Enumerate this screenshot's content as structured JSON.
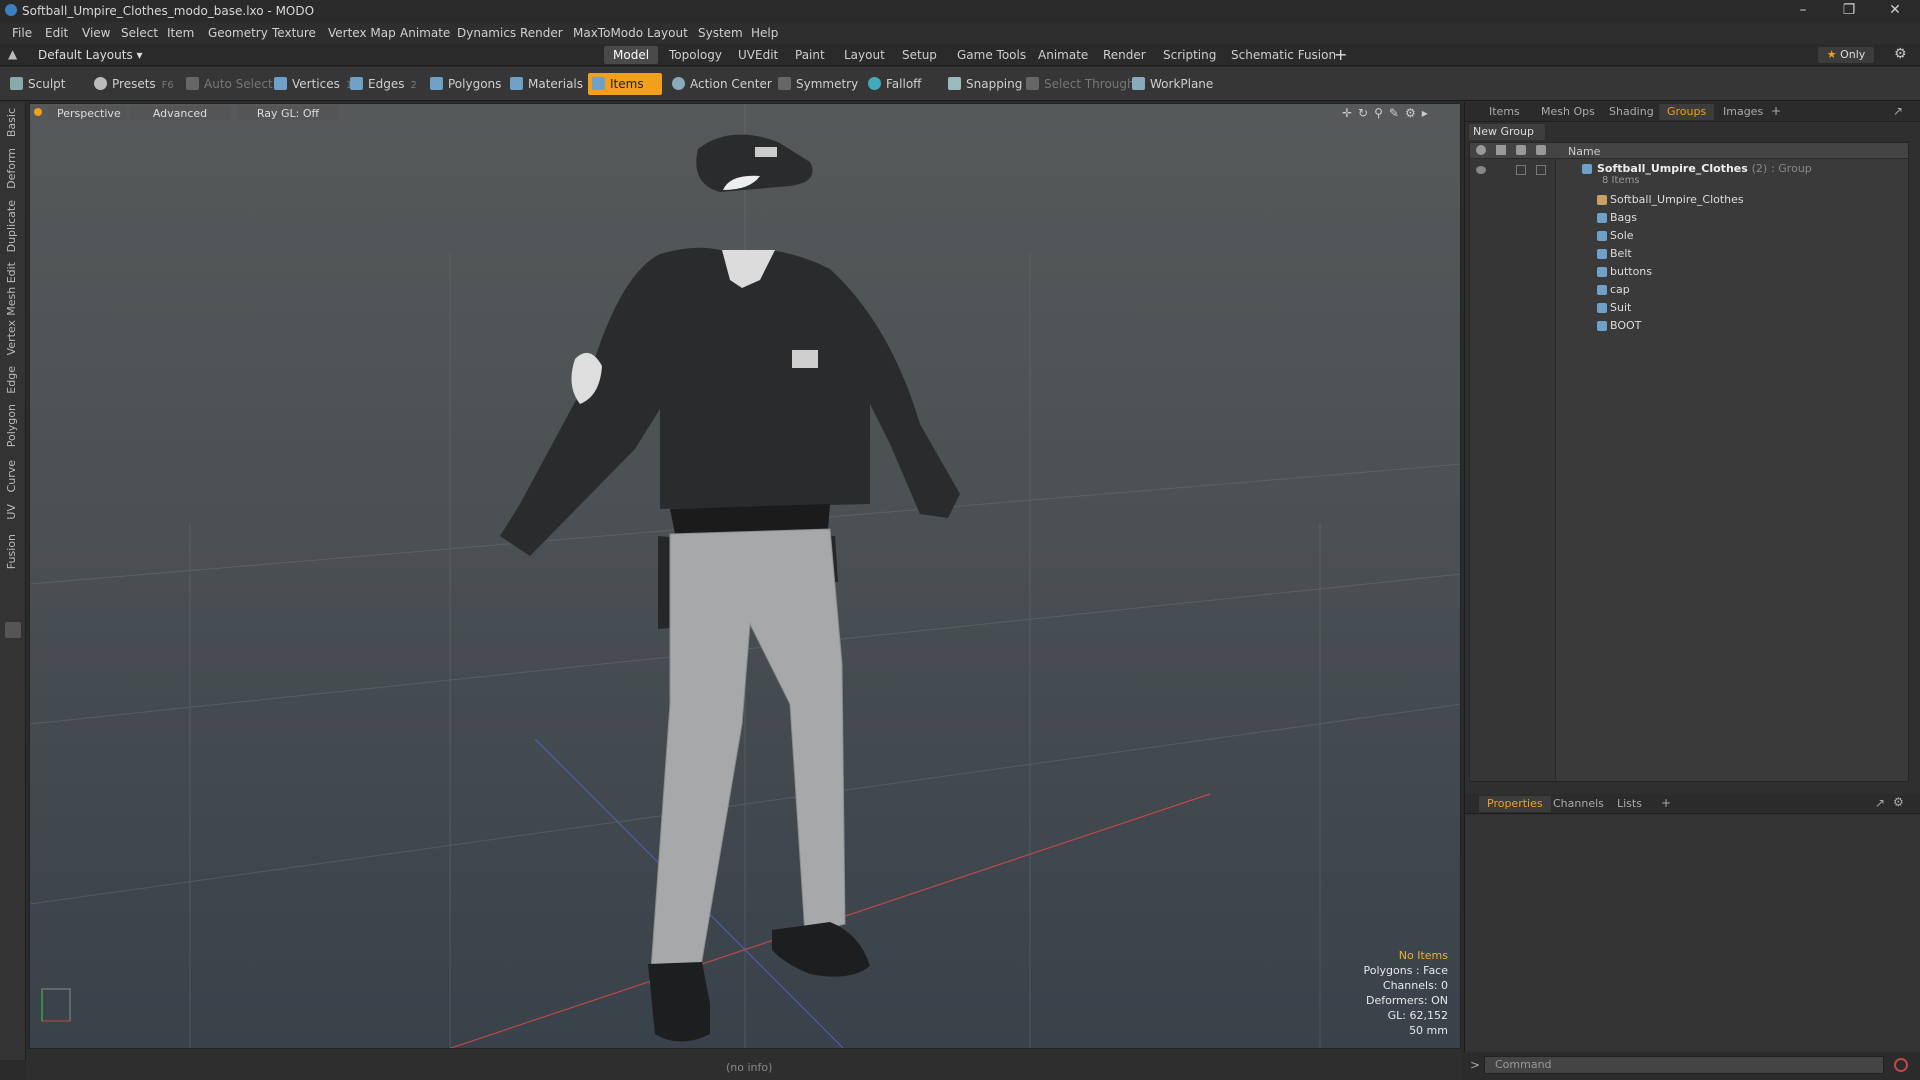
{
  "window": {
    "title": "Softball_Umpire_Clothes_modo_base.lxo - MODO"
  },
  "menu": [
    "File",
    "Edit",
    "View",
    "Select",
    "Item",
    "Geometry",
    "Texture",
    "Vertex Map",
    "Animate",
    "Dynamics",
    "Render",
    "MaxToModo",
    "Layout",
    "System",
    "Help"
  ],
  "layout": {
    "selector": "Default Layouts",
    "only_label": "Only"
  },
  "tabs": [
    "Model",
    "Topology",
    "UVEdit",
    "Paint",
    "Layout",
    "Setup",
    "Game Tools",
    "Animate",
    "Render",
    "Scripting",
    "Schematic Fusion"
  ],
  "active_tab": "Model",
  "toolbar": {
    "sculpt": "Sculpt",
    "presets": "Presets",
    "presets_key": "F6",
    "auto_select": "Auto Select",
    "vertices": "Vertices",
    "vertices_count": "1",
    "edges": "Edges",
    "edges_count": "2",
    "polygons": "Polygons",
    "materials": "Materials",
    "items": "Items",
    "action_center": "Action Center",
    "symmetry": "Symmetry",
    "falloff": "Falloff",
    "snapping": "Snapping",
    "select_through": "Select Through",
    "workplane": "WorkPlane"
  },
  "left_tabs": [
    "Basic",
    "Deform",
    "Duplicate",
    "Mesh Edit",
    "Vertex",
    "Edge",
    "Polygon",
    "Curve",
    "UV",
    "Fusion"
  ],
  "viewport": {
    "view_label": "Perspective",
    "shading_label": "Advanced",
    "raygl_label": "Ray GL: Off",
    "stats": {
      "selection": "No Items",
      "polygons": "Polygons : Face",
      "channels": "Channels: 0",
      "deformers": "Deformers: ON",
      "gl": "GL: 62,152",
      "scale": "50 mm"
    }
  },
  "status": {
    "info": "(no info)"
  },
  "right_panel": {
    "tabs": [
      "Items",
      "Mesh Ops",
      "Shading",
      "Groups",
      "Images"
    ],
    "active_tab": "Groups",
    "new_group": "New Group",
    "column_name": "Name",
    "group": {
      "name": "Softball_Umpire_Clothes",
      "count": "(2)",
      "type": ": Group",
      "items_label": "8 Items"
    },
    "members": [
      "Softball_Umpire_Clothes",
      "Bags",
      "Sole",
      "Belt",
      "buttons",
      "cap",
      "Suit",
      "BOOT"
    ],
    "bottom_tabs": [
      "Properties",
      "Channels",
      "Lists"
    ],
    "bottom_active": "Properties"
  },
  "command": {
    "placeholder": "Command"
  },
  "colors": {
    "accent": "#f0a01c",
    "selection_text": "#f0b030"
  }
}
